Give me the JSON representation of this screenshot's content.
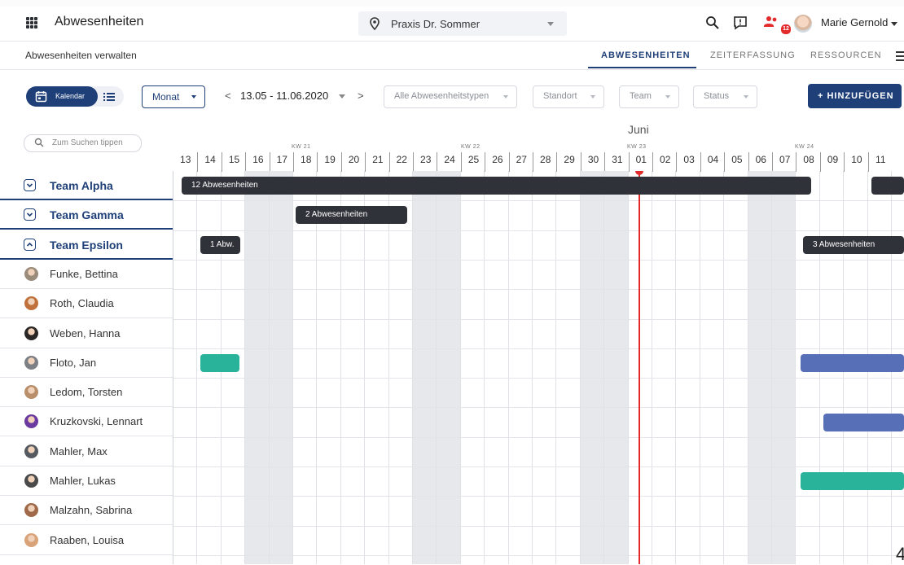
{
  "app": {
    "title": "Abwesenheiten"
  },
  "location": {
    "value": "Praxis Dr. Sommer"
  },
  "user": {
    "name": "Marie Gernold",
    "notification_count": "12"
  },
  "subheader": {
    "title": "Abwesenheiten verwalten",
    "tabs": [
      {
        "label": "ABWESENHEITEN",
        "active": true
      },
      {
        "label": "ZEITERFASSUNG",
        "active": false
      },
      {
        "label": "RESSOURCEN",
        "active": false
      }
    ]
  },
  "filters": {
    "view_calendar_label": "Kalendar",
    "period": "Monat",
    "date_range": "13.05 - 11.06.2020",
    "prev": "<",
    "next": ">",
    "absence_types": "Alle Abwesenheitstypen",
    "location": "Standort",
    "team": "Team",
    "status": "Status",
    "add_label": "+ HINZUFÜGEN"
  },
  "search": {
    "placeholder": "Zum Suchen tippen"
  },
  "timeline": {
    "month": "Juni",
    "weeks": [
      "KW 21",
      "KW 22",
      "KW 23",
      "KW 24"
    ],
    "days": [
      "13",
      "14",
      "15",
      "16",
      "17",
      "18",
      "19",
      "20",
      "21",
      "22",
      "23",
      "24",
      "25",
      "26",
      "27",
      "28",
      "29",
      "30",
      "31",
      "01",
      "02",
      "03",
      "04",
      "05",
      "06",
      "07",
      "08",
      "09",
      "10",
      "11"
    ]
  },
  "rows": [
    {
      "type": "team",
      "name": "Team Alpha",
      "expanded": false
    },
    {
      "type": "team",
      "name": "Team Gamma",
      "expanded": false
    },
    {
      "type": "team",
      "name": "Team Epsilon",
      "expanded": true
    },
    {
      "type": "person",
      "name": "Funke, Bettina"
    },
    {
      "type": "person",
      "name": "Roth, Claudia"
    },
    {
      "type": "person",
      "name": "Weben, Hanna"
    },
    {
      "type": "person",
      "name": "Floto, Jan"
    },
    {
      "type": "person",
      "name": "Ledom, Torsten"
    },
    {
      "type": "person",
      "name": "Kruzkovski, Lennart"
    },
    {
      "type": "person",
      "name": "Mahler, Max"
    },
    {
      "type": "person",
      "name": "Mahler, Lukas"
    },
    {
      "type": "person",
      "name": "Malzahn, Sabrina"
    },
    {
      "type": "person",
      "name": "Raaben, Louisa"
    }
  ],
  "absences": {
    "alpha_main": "12 Abwesenheiten",
    "gamma_main": "2 Abwesenheiten",
    "epsilon_short": "1 Abw.",
    "epsilon_main": "3 Abwesenheiten"
  },
  "colors": {
    "primary": "#1e3f78",
    "today": "#e32b2b",
    "teal": "#29b39a",
    "blue": "#566fb6",
    "dark": "#30323a"
  },
  "corner_text": "4"
}
